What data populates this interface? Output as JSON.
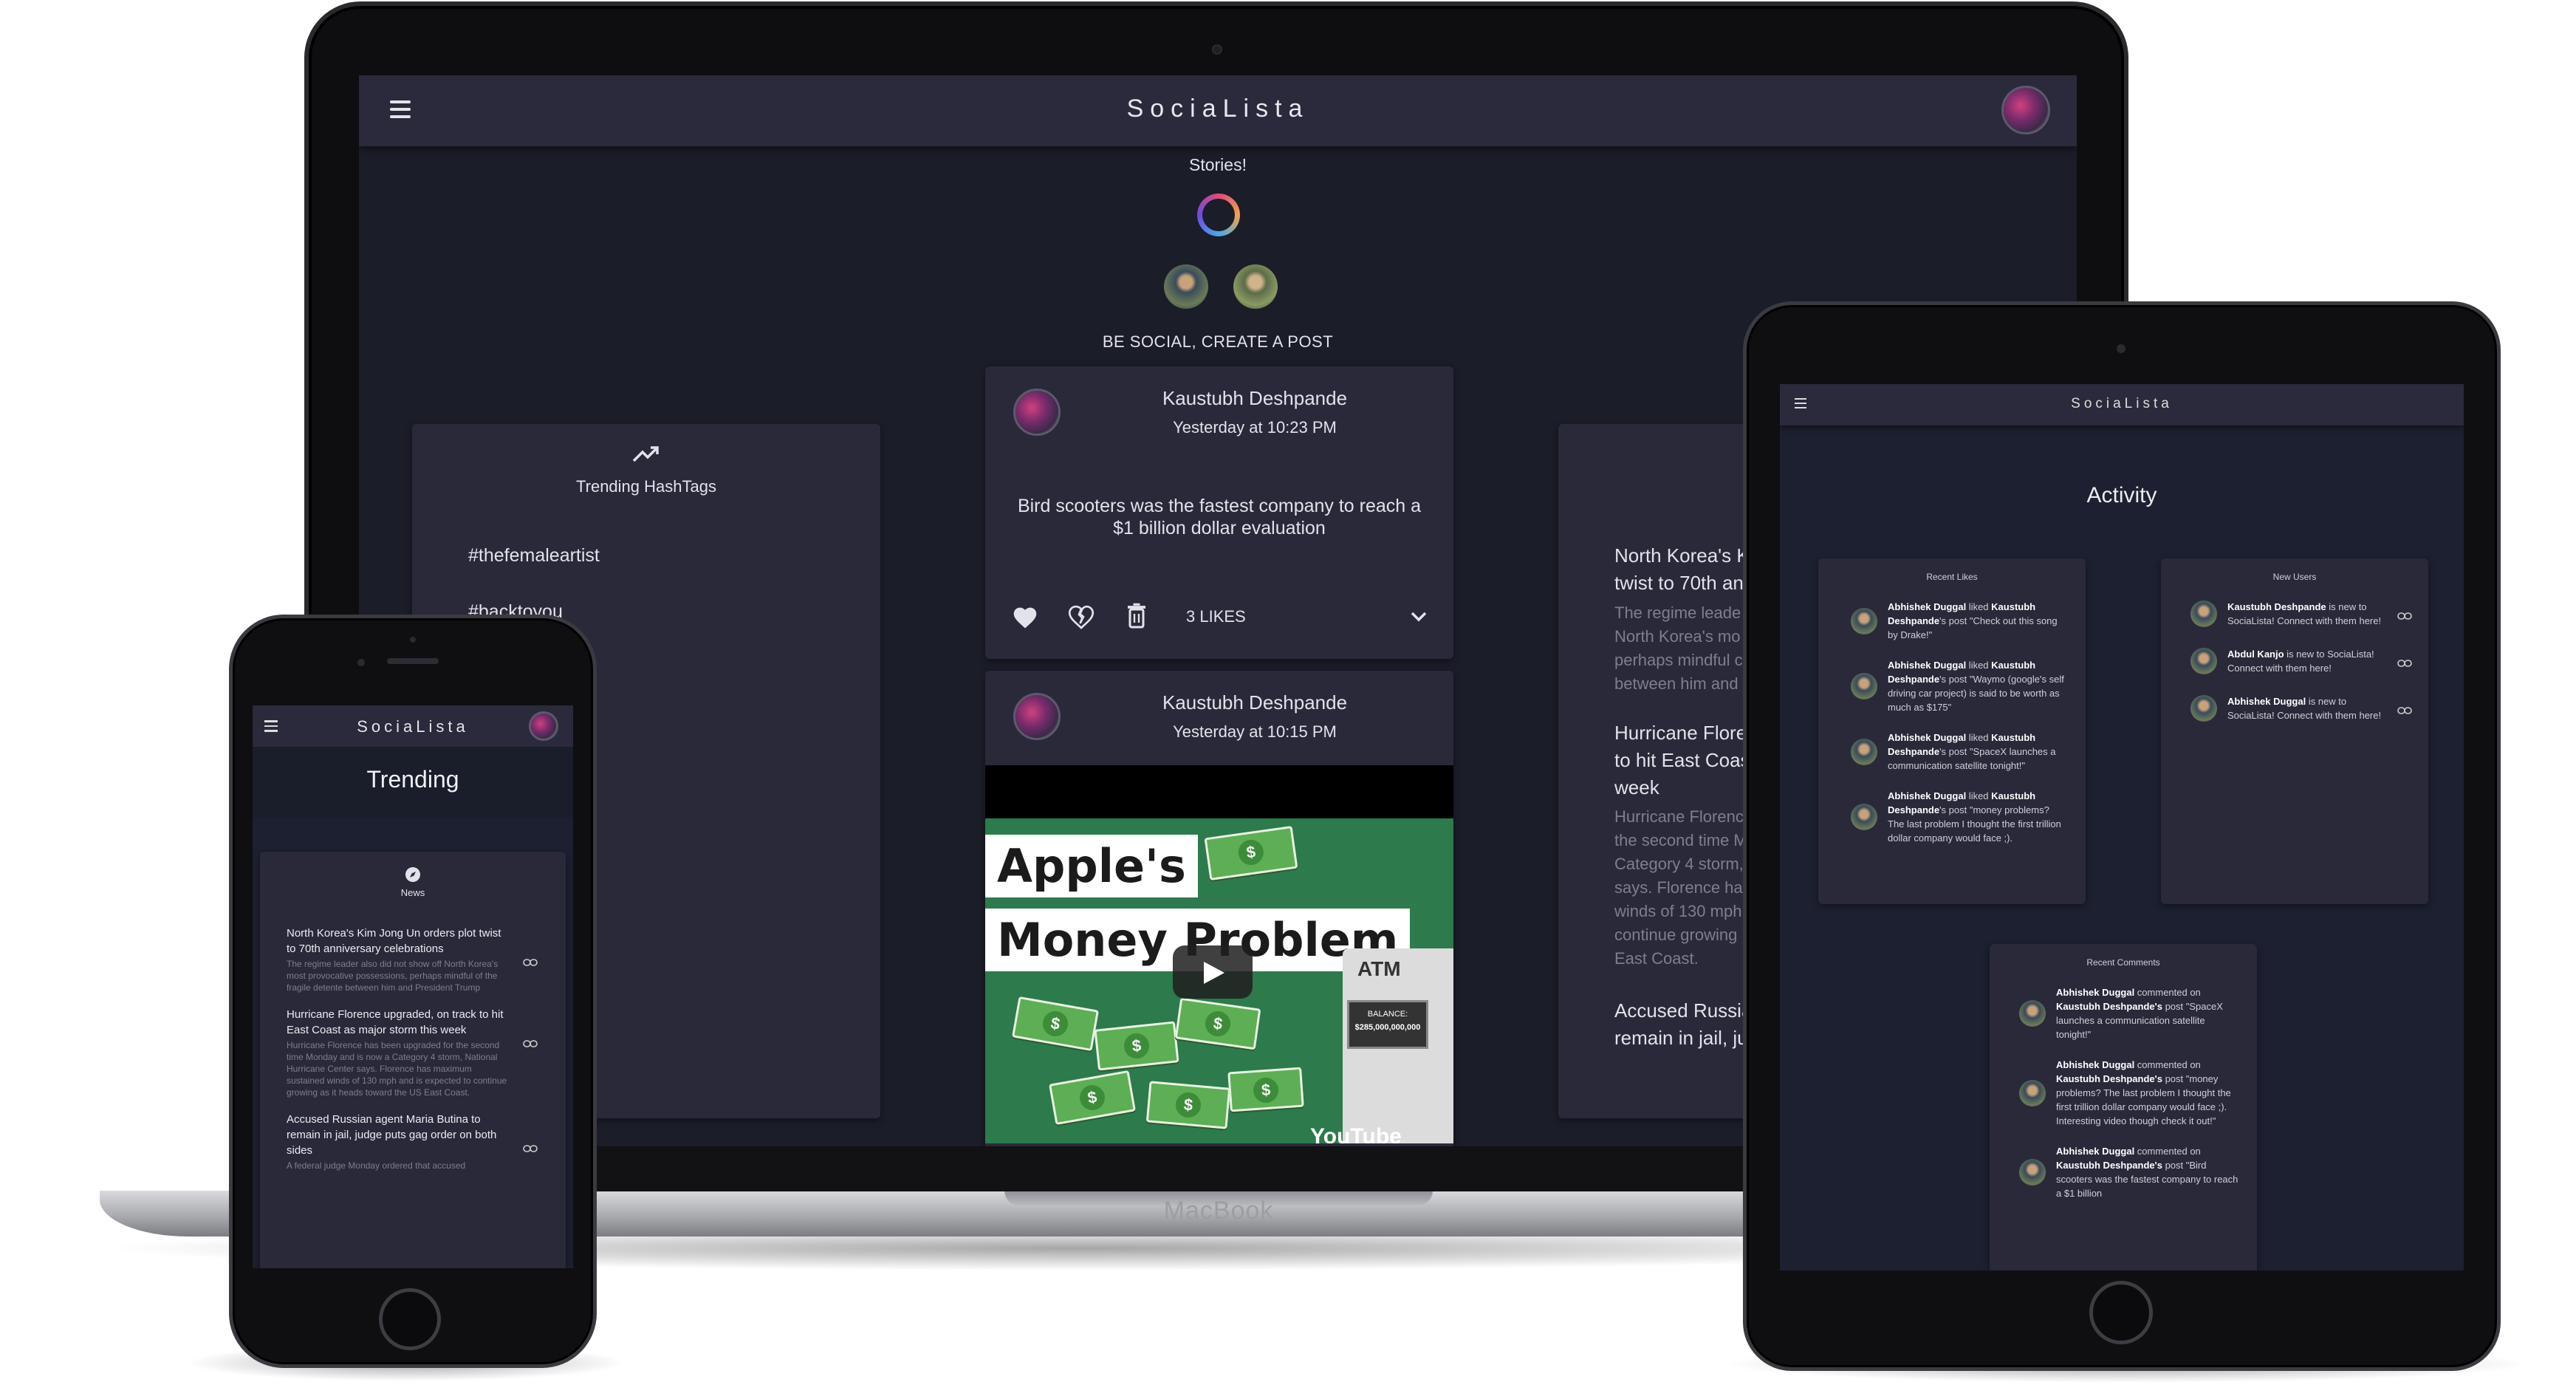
{
  "laptop": {
    "brand_label": "MacBook",
    "app": {
      "title": "SociaLista",
      "stories_label": "Stories!",
      "create_post_label": "BE SOCIAL, CREATE A POST",
      "trending": {
        "title": "Trending HashTags",
        "tags": [
          "#thefemaleartist",
          "#backtoyou"
        ]
      },
      "posts": [
        {
          "author": "Kaustubh Deshpande",
          "time": "Yesterday at 10:23 PM",
          "body": "Bird scooters was the fastest company to reach a $1 billion dollar evaluation",
          "likes_label": "3 LIKES"
        },
        {
          "author": "Kaustubh Deshpande",
          "time": "Yesterday at 10:15 PM",
          "video": {
            "title_line1": "Apple's",
            "title_line2": "Money Problem",
            "atm_label": "ATM",
            "balance_label": "BALANCE:",
            "balance_value": "$285,000,000,000",
            "youtube_label": "YouTube"
          }
        }
      ],
      "news_partial": [
        {
          "title": "North Korea's K twist to 70th an",
          "excerpt": "The regime leade North Korea's mo perhaps mindful c between him and"
        },
        {
          "title": "Hurricane Flore to hit East Coas week",
          "excerpt": "Hurricane Florenc the second time M Category 4 storm, says. Florence ha winds of 130 mph continue growing East Coast."
        },
        {
          "title": "Accused Russia remain in jail, ju",
          "excerpt": ""
        }
      ]
    }
  },
  "phone": {
    "app_title": "SociaLista",
    "page_title": "Trending",
    "news_label": "News",
    "articles": [
      {
        "title": "North Korea's Kim Jong Un orders plot twist to 70th anniversary celebrations",
        "excerpt": "The regime leader also did not show off North Korea's most provocative possessions, perhaps mindful of the fragile detente between him and President Trump"
      },
      {
        "title": "Hurricane Florence upgraded, on track to hit East Coast as major storm this week",
        "excerpt": "Hurricane Florence has been upgraded for the second time Monday and is now a Category 4 storm, National Hurricane Center says. Florence has maximum sustained winds of 130 mph and is expected to continue growing as it heads toward the US East Coast."
      },
      {
        "title": "Accused Russian agent Maria Butina to remain in jail, judge puts gag order on both sides",
        "excerpt": "A federal judge Monday ordered that accused"
      }
    ]
  },
  "tablet": {
    "app_title": "SociaLista",
    "page_title": "Activity",
    "recent_likes": {
      "title": "Recent Likes",
      "items": [
        {
          "user": "Abhishek Duggal",
          "verb": " liked ",
          "target": "Kaustubh Deshpande",
          "rest": "'s post \"Check out this song by Drake!\""
        },
        {
          "user": "Abhishek Duggal",
          "verb": " liked ",
          "target": "Kaustubh Deshpande",
          "rest": "'s post \"Waymo (google's self driving car project) is said to be worth as much as $175\""
        },
        {
          "user": "Abhishek Duggal",
          "verb": " liked ",
          "target": "Kaustubh Deshpande",
          "rest": "'s post \"SpaceX launches a communication satellite tonight!\""
        },
        {
          "user": "Abhishek Duggal",
          "verb": " liked ",
          "target": "Kaustubh Deshpande",
          "rest": "'s post \"money problems? The last problem I thought the first trillion dollar company would face ;)."
        }
      ]
    },
    "new_users": {
      "title": "New Users",
      "items": [
        {
          "user": "Kaustubh Deshpande",
          "rest": " is new to SociaLista! Connect with them here!"
        },
        {
          "user": "Abdul Kanjo",
          "rest": " is new to SociaLista! Connect with them here!"
        },
        {
          "user": "Abhishek Duggal",
          "rest": " is new to SociaLista! Connect with them here!"
        }
      ]
    },
    "recent_comments": {
      "title": "Recent Comments",
      "items": [
        {
          "user": "Abhishek Duggal",
          "verb": " commented on ",
          "target": "Kaustubh Deshpande's",
          "rest": " post \"SpaceX launches a communication satellite tonight!\""
        },
        {
          "user": "Abhishek Duggal",
          "verb": " commented on ",
          "target": "Kaustubh Deshpande's",
          "rest": " post \"money problems? The last problem I thought the first trillion dollar company would face ;). Interesting video though check it out!\""
        },
        {
          "user": "Abhishek Duggal",
          "verb": " commented on ",
          "target": "Kaustubh Deshpande's",
          "rest": " post \"Bird scooters was the fastest company to reach a $1 billion"
        }
      ]
    }
  }
}
